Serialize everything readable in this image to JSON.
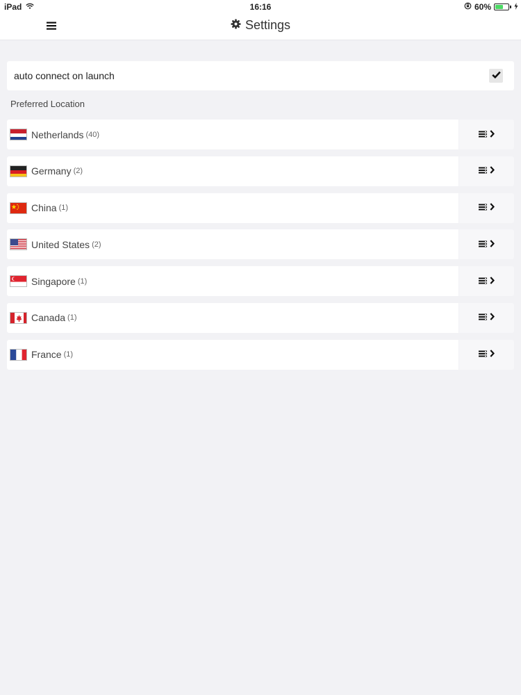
{
  "status_bar": {
    "device": "iPad",
    "time": "16:16",
    "battery": "60%",
    "battery_level": 0.6
  },
  "nav": {
    "title": "Settings"
  },
  "settings": {
    "auto_connect_label": "auto connect on launch",
    "auto_connect_checked": true,
    "preferred_location_label": "Preferred Location"
  },
  "locations": [
    {
      "name": "Netherlands",
      "count": "(40)"
    },
    {
      "name": "Germany",
      "count": "(2)"
    },
    {
      "name": "China",
      "count": "(1)"
    },
    {
      "name": "United States",
      "count": "(2)"
    },
    {
      "name": "Singapore",
      "count": "(1)"
    },
    {
      "name": "Canada",
      "count": "(1)"
    },
    {
      "name": "France",
      "count": "(1)"
    }
  ],
  "icons": {
    "menu": "hamburger-icon",
    "settings": "gear-icon",
    "check": "checkmark-icon",
    "server_list": "server-list-icon",
    "chevron": "chevron-right-icon"
  }
}
